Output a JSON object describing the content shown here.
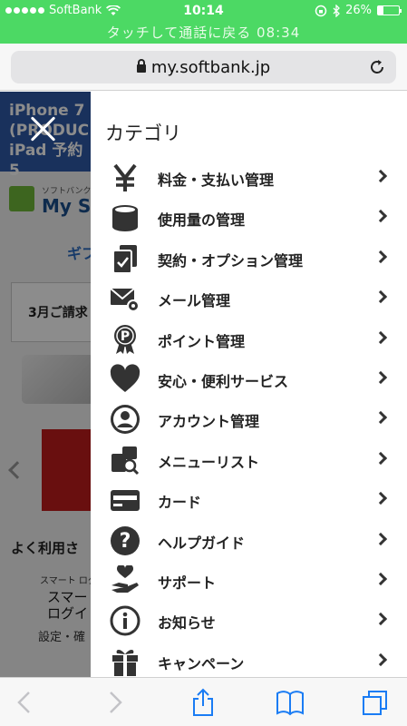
{
  "status_bar": {
    "carrier": "SoftBank",
    "time": "10:14",
    "battery": "26%",
    "battery_level": 0.26,
    "call_banner": "タッチして通話に戻る 08:34"
  },
  "browser": {
    "url": "my.softbank.jp"
  },
  "background_page": {
    "banner_line1": "iPhone 7",
    "banner_line2": "(PRODUC",
    "banner_line3": "iPad 予約5",
    "logo_small": "ソフトバンク",
    "logo_big": "My So",
    "gift": "ギフ",
    "bill": "3月ご請求",
    "often": "よく利用さ",
    "smart_label": "スマート ログ",
    "smart_main_1": "スマー",
    "smart_main_2": "ログイ",
    "smart_sub": "設定・確"
  },
  "drawer": {
    "title": "カテゴリ",
    "items": [
      {
        "label": "料金・支払い管理",
        "icon": "yen-icon"
      },
      {
        "label": "使用量の管理",
        "icon": "database-icon"
      },
      {
        "label": "契約・オプション管理",
        "icon": "contract-check-icon"
      },
      {
        "label": "メール管理",
        "icon": "mail-gear-icon"
      },
      {
        "label": "ポイント管理",
        "icon": "point-badge-icon"
      },
      {
        "label": "安心・便利サービス",
        "icon": "heart-icon"
      },
      {
        "label": "アカウント管理",
        "icon": "account-icon"
      },
      {
        "label": "メニューリスト",
        "icon": "menu-list-search-icon"
      },
      {
        "label": "カード",
        "icon": "card-icon"
      },
      {
        "label": "ヘルプガイド",
        "icon": "help-icon"
      },
      {
        "label": "サポート",
        "icon": "support-hand-icon"
      },
      {
        "label": "お知らせ",
        "icon": "info-icon"
      },
      {
        "label": "キャンペーン",
        "icon": "gift-icon"
      }
    ]
  },
  "colors": {
    "status_green": "#4cd964",
    "icon_dark": "#333333"
  }
}
